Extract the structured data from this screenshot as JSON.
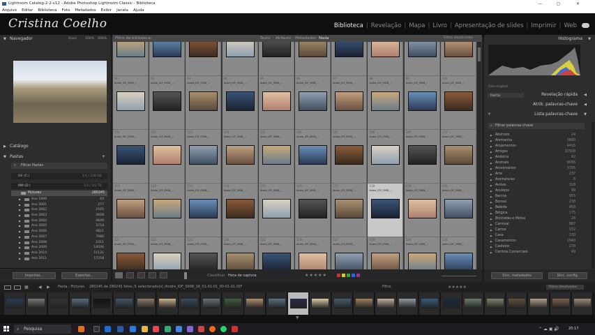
{
  "window": {
    "title": "Lightroom Catalog-2-2-v12 - Adobe Photoshop Lightroom Classic - Biblioteca",
    "minimize": "—",
    "maximize": "◻",
    "close": "✕"
  },
  "menu": [
    "Arquivo",
    "Editar",
    "Biblioteca",
    "Foto",
    "Metadados",
    "Exibir",
    "Janela",
    "Ajuda"
  ],
  "identity": {
    "name": "Cristina Coelho"
  },
  "modules": [
    "Biblioteca",
    "Revelação",
    "Mapa",
    "Livro",
    "Apresentação de slides",
    "Imprimir",
    "Web"
  ],
  "left": {
    "navigator": "Navegador",
    "nav_fit": "Ajust.",
    "nav_100": "100%",
    "nav_400": "400%",
    "catalog": "Catálogo",
    "folders": "Pastas",
    "filter_folders": "Filtrar Pastas",
    "volumes": [
      {
        "name": "OS (C:)",
        "size": "1/4 / 238 GB"
      },
      {
        "name": "MM (D:)",
        "size": "1/2 / 1/2 TB"
      }
    ],
    "root": {
      "name": "Pictures",
      "count": "280245"
    },
    "folders_list": [
      {
        "name": "Ano 1999",
        "count": "43"
      },
      {
        "name": "Ano 2001",
        "count": "277"
      },
      {
        "name": "Ano 2002",
        "count": "2165"
      },
      {
        "name": "Ano 2003",
        "count": "3658"
      },
      {
        "name": "Ano 2004",
        "count": "4649"
      },
      {
        "name": "Ano 2005",
        "count": "3718"
      },
      {
        "name": "Ano 2006",
        "count": "4621"
      },
      {
        "name": "Ano 2007",
        "count": "7080"
      },
      {
        "name": "Ano 2008",
        "count": "2311"
      },
      {
        "name": "Ano 2009",
        "count": "14546"
      },
      {
        "name": "Ano 2010",
        "count": "11131"
      },
      {
        "name": "Ano 2011",
        "count": "17218"
      }
    ],
    "import_btn": "Importar...",
    "export_btn": "Exportar..."
  },
  "grid": {
    "filter_title": "Filtro da biblioteca:",
    "filter_tabs": [
      "Texto",
      "Atributo",
      "Metadados",
      "Nada"
    ],
    "filter_right": "Filtros desativados",
    "rows": [
      {
        "nums": [
          "",
          "",
          "",
          "",
          "",
          "",
          "",
          "",
          "",
          ""
        ]
      },
      {
        "nums": [
          "91",
          "92",
          "93",
          "94",
          "95",
          "96",
          "97",
          "98",
          "99",
          "100"
        ]
      },
      {
        "nums": [
          "101",
          "102",
          "103",
          "104",
          "105",
          "106",
          "107",
          "108",
          "109",
          "110"
        ]
      },
      {
        "nums": [
          "111",
          "112",
          "113",
          "114",
          "115",
          "116",
          "117",
          "118",
          "119",
          "120"
        ]
      },
      {
        "nums": [
          "121",
          "122",
          "123",
          "124",
          "125",
          "126",
          "127",
          "128",
          "129",
          "130"
        ]
      }
    ],
    "selected_row": 3,
    "selected_col": 7,
    "filename_caption": "Andre_IOF_0908_..."
  },
  "toolbar": {
    "paint_label": "Classificar",
    "sort_label": "Hora de captura",
    "filter_label": "Filtro:"
  },
  "right": {
    "histogram": "Histograma",
    "original_photo": "Foto original",
    "quick_develop": "Revelação rápida",
    "quick_preset": "Padrão",
    "keywording": "Atrib. palavras-chave",
    "keyword_list": "Lista palavras-chave",
    "filter_keywords": "Filtrar palavras-chave",
    "keywords": [
      {
        "name": "Abstrato",
        "count": "24"
      },
      {
        "name": "Alemanha",
        "count": "3690"
      },
      {
        "name": "Alojamentos",
        "count": "4416"
      },
      {
        "name": "Amigos",
        "count": "22508"
      },
      {
        "name": "Andorra",
        "count": "42"
      },
      {
        "name": "Animais",
        "count": "9066"
      },
      {
        "name": "Aniversários",
        "count": "3705"
      },
      {
        "name": "Arte",
        "count": "237"
      },
      {
        "name": "Assinaturas",
        "count": "8"
      },
      {
        "name": "Aviões",
        "count": "318"
      },
      {
        "name": "Azulejos",
        "count": "99"
      },
      {
        "name": "Barcos",
        "count": "955"
      },
      {
        "name": "Bonsai",
        "count": "238"
      },
      {
        "name": "Bebida",
        "count": "458"
      },
      {
        "name": "Bélgica",
        "count": "175"
      },
      {
        "name": "Bicicletas e Motos",
        "count": "26"
      },
      {
        "name": "Carnival",
        "count": "687"
      },
      {
        "name": "Carros",
        "count": "332"
      },
      {
        "name": "Casa",
        "count": "130"
      },
      {
        "name": "Casamentos",
        "count": "1940"
      },
      {
        "name": "Castelos",
        "count": "278"
      },
      {
        "name": "Centros Comerciais",
        "count": "49"
      }
    ],
    "sync_meta": "Sinc. metadados",
    "sync_settings": "Sinc. config."
  },
  "filmstrip": {
    "path": "Pasta : Pictures",
    "info": "280245 de 280245 fotos /1 selecionado(s) /Andre_IOF_0908_16_01-01-01_00-01-01.IOF",
    "filter": "Filtro:",
    "filter_state": "Filtros desativados"
  },
  "taskbar": {
    "search": "Pesquisa",
    "time": "20:17",
    "date": "01/01/01"
  }
}
